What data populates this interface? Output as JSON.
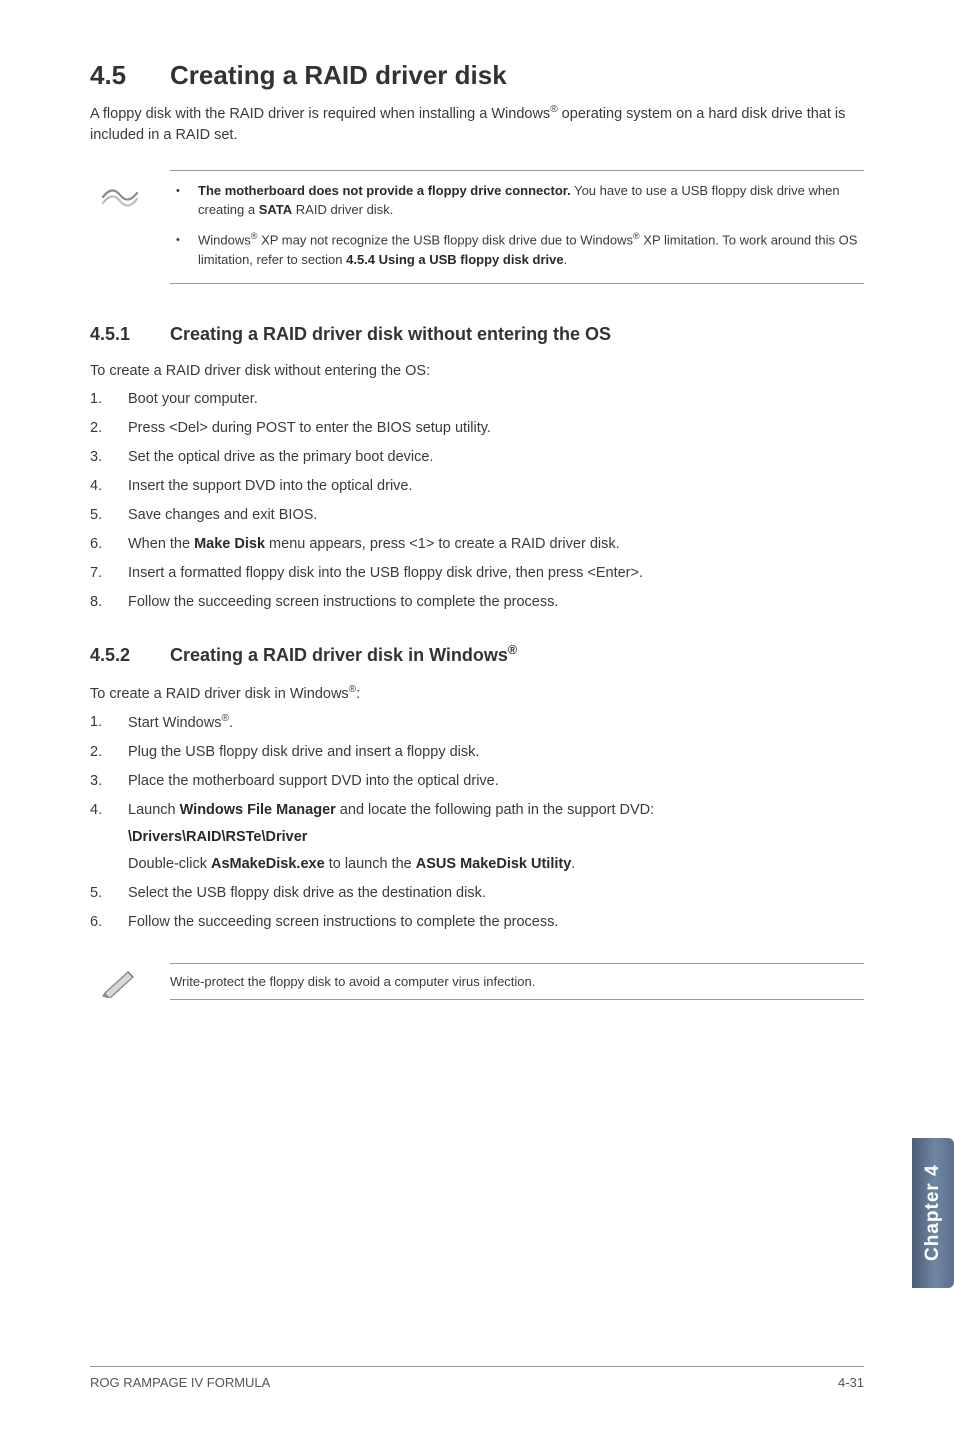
{
  "section": {
    "number": "4.5",
    "title": "Creating a RAID driver disk"
  },
  "intro": {
    "pre": "A floppy disk with the RAID driver is required when installing a Windows",
    "sup": "®",
    "post": " operating system on a hard disk drive that is included in a RAID set."
  },
  "notes": [
    {
      "bold_pre": "The motherboard does not provide a floppy drive connector.",
      "plain": " You have to use a USB floppy disk drive when creating a ",
      "bold_mid": "SATA",
      "plain2": " RAID driver disk."
    },
    {
      "plain_pre": "Windows",
      "sup1": "®",
      "plain_mid1": " XP may not recognize the USB floppy disk drive due to Windows",
      "sup2": "®",
      "plain_mid2": " XP limitation. To work around this OS limitation, refer to section ",
      "bold": "4.5.4 Using a USB floppy disk drive",
      "plain_post": "."
    }
  ],
  "sub1": {
    "number": "4.5.1",
    "title": "Creating a RAID driver disk without entering the OS",
    "lead": "To create a RAID driver disk without entering the OS:",
    "steps": [
      "Boot your computer.",
      "Press <Del> during POST to enter the BIOS setup utility.",
      "Set the optical drive as the primary boot device.",
      "Insert the support DVD into the optical drive.",
      "Save changes and exit BIOS."
    ],
    "step6_pre": "When the ",
    "step6_bold": "Make Disk",
    "step6_post": " menu appears, press <1> to create a RAID driver disk.",
    "step7": "Insert a formatted floppy disk into the USB floppy disk drive, then press <Enter>.",
    "step8": "Follow the succeeding screen instructions to complete the process."
  },
  "sub2": {
    "number": "4.5.2",
    "title_pre": "Creating a RAID driver disk in Windows",
    "title_sup": "®",
    "lead_pre": "To create a RAID driver disk in Windows",
    "lead_sup": "®",
    "lead_post": ":",
    "step1_pre": "Start Windows",
    "step1_sup": "®",
    "step1_post": ".",
    "step2": "Plug the USB floppy disk drive and insert a floppy disk.",
    "step3": "Place the motherboard support DVD into the optical drive.",
    "step4_pre": "Launch ",
    "step4_b1": "Windows File Manager",
    "step4_mid": " and locate the following path in the support DVD:",
    "step4_path": "\\Drivers\\RAID\\RSTe\\Driver",
    "step4_line2_pre": "Double-click ",
    "step4_line2_b1": "AsMakeDisk.exe",
    "step4_line2_mid": " to launch the ",
    "step4_line2_b2": "ASUS MakeDisk Utility",
    "step4_line2_post": ".",
    "step5": "Select the USB floppy disk drive as the destination disk.",
    "step6": "Follow the succeeding screen instructions to complete the process."
  },
  "tip": "Write-protect the floppy disk to avoid a computer virus infection.",
  "tab": "Chapter 4",
  "footer_left": "ROG RAMPAGE IV FORMULA",
  "footer_right": "4-31"
}
